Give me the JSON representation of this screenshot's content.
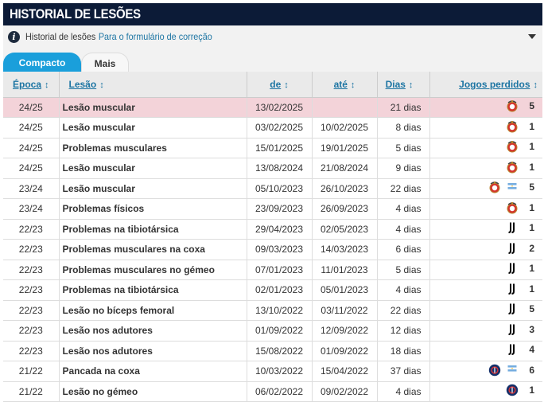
{
  "header": {
    "title": "HISTORIAL DE LESÕES"
  },
  "infobar": {
    "label": "Historial de lesões",
    "link": "Para o formulário de correção"
  },
  "tabs": [
    {
      "label": "Compacto",
      "active": true
    },
    {
      "label": "Mais",
      "active": false
    }
  ],
  "columns": {
    "season": "Época",
    "injury": "Lesão",
    "from": "de",
    "until": "até",
    "days": "Dias",
    "games": "Jogos perdidos"
  },
  "rows": [
    {
      "season": "24/25",
      "injury": "Lesão muscular",
      "from": "13/02/2025",
      "until": "",
      "days": "21 dias",
      "games": "5",
      "clubs": [
        "benfica-crest"
      ],
      "highlight": true
    },
    {
      "season": "24/25",
      "injury": "Lesão muscular",
      "from": "03/02/2025",
      "until": "10/02/2025",
      "days": "8 dias",
      "games": "1",
      "clubs": [
        "benfica-crest"
      ]
    },
    {
      "season": "24/25",
      "injury": "Problemas musculares",
      "from": "15/01/2025",
      "until": "19/01/2025",
      "days": "5 dias",
      "games": "1",
      "clubs": [
        "benfica-crest"
      ]
    },
    {
      "season": "24/25",
      "injury": "Lesão muscular",
      "from": "13/08/2024",
      "until": "21/08/2024",
      "days": "9 dias",
      "games": "1",
      "clubs": [
        "benfica-crest"
      ]
    },
    {
      "season": "23/24",
      "injury": "Lesão muscular",
      "from": "05/10/2023",
      "until": "26/10/2023",
      "days": "22 dias",
      "games": "5",
      "clubs": [
        "benfica-crest",
        "argentina-flag"
      ]
    },
    {
      "season": "23/24",
      "injury": "Problemas físicos",
      "from": "23/09/2023",
      "until": "26/09/2023",
      "days": "4 dias",
      "games": "1",
      "clubs": [
        "benfica-crest"
      ]
    },
    {
      "season": "22/23",
      "injury": "Problemas na tibiotársica",
      "from": "29/04/2023",
      "until": "02/05/2023",
      "days": "4 dias",
      "games": "1",
      "clubs": [
        "juventus-crest"
      ]
    },
    {
      "season": "22/23",
      "injury": "Problemas musculares na coxa",
      "from": "09/03/2023",
      "until": "14/03/2023",
      "days": "6 dias",
      "games": "2",
      "clubs": [
        "juventus-crest"
      ]
    },
    {
      "season": "22/23",
      "injury": "Problemas musculares no gémeo",
      "from": "07/01/2023",
      "until": "11/01/2023",
      "days": "5 dias",
      "games": "1",
      "clubs": [
        "juventus-crest"
      ]
    },
    {
      "season": "22/23",
      "injury": "Problemas na tibiotársica",
      "from": "02/01/2023",
      "until": "05/01/2023",
      "days": "4 dias",
      "games": "1",
      "clubs": [
        "juventus-crest"
      ]
    },
    {
      "season": "22/23",
      "injury": "Lesão no bíceps femoral",
      "from": "13/10/2022",
      "until": "03/11/2022",
      "days": "22 dias",
      "games": "5",
      "clubs": [
        "juventus-crest"
      ]
    },
    {
      "season": "22/23",
      "injury": "Lesão nos adutores",
      "from": "01/09/2022",
      "until": "12/09/2022",
      "days": "12 dias",
      "games": "3",
      "clubs": [
        "juventus-crest"
      ]
    },
    {
      "season": "22/23",
      "injury": "Lesão nos adutores",
      "from": "15/08/2022",
      "until": "01/09/2022",
      "days": "18 dias",
      "games": "4",
      "clubs": [
        "juventus-crest"
      ]
    },
    {
      "season": "21/22",
      "injury": "Pancada na coxa",
      "from": "10/03/2022",
      "until": "15/04/2022",
      "days": "37 dias",
      "games": "6",
      "clubs": [
        "psg-crest",
        "argentina-flag"
      ]
    },
    {
      "season": "21/22",
      "injury": "Lesão no gémeo",
      "from": "06/02/2022",
      "until": "09/02/2022",
      "days": "4 dias",
      "games": "1",
      "clubs": [
        "psg-crest"
      ]
    }
  ],
  "colors": {
    "header_bg": "#0c1b37",
    "tab_active": "#1a9fdb",
    "link": "#1d75a3",
    "highlight_row": "#f3d3d9"
  }
}
